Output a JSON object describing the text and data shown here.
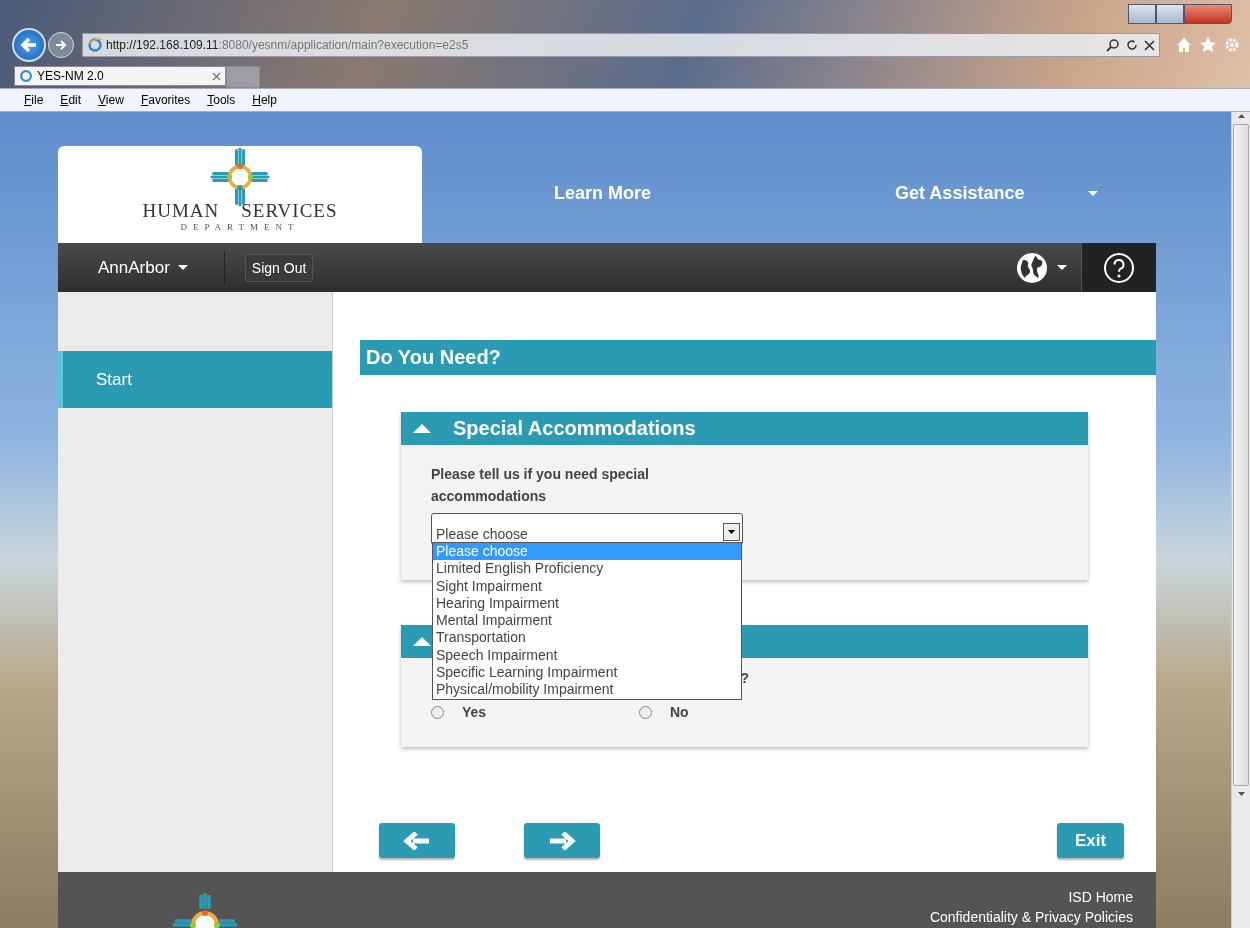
{
  "browser": {
    "address_host": "http://192.168.109.11",
    "address_rest": ":8080/yesnm/application/main?execution=e2s5",
    "tab_title": "YES-NM 2.0",
    "menu": [
      "File",
      "Edit",
      "View",
      "Favorites",
      "Tools",
      "Help"
    ]
  },
  "header": {
    "logo_word_left": "HUMAN",
    "logo_word_right": "SERVICES",
    "logo_subtitle": "DEPARTMENT",
    "nav": [
      "Learn More",
      "Get Assistance"
    ]
  },
  "userbar": {
    "user": "AnnArbor",
    "sign_out": "Sign Out"
  },
  "sidebar": {
    "items": [
      {
        "label": "Start",
        "selected": true
      }
    ]
  },
  "page_title": "Do You Need?",
  "accommodations": {
    "title": "Special Accommodations",
    "prompt": "Please tell us if you need special accommodations",
    "select": {
      "value": "Please choose",
      "expanded": true,
      "options": [
        {
          "label": "Please choose",
          "selected": true
        },
        {
          "label": "Limited English Proficiency",
          "selected": false
        },
        {
          "label": "Sight Impairment",
          "selected": false
        },
        {
          "label": "Hearing Impairment",
          "selected": false
        },
        {
          "label": "Mental Impairment",
          "selected": false
        },
        {
          "label": "Transportation",
          "selected": false
        },
        {
          "label": "Speech Impairment",
          "selected": false
        },
        {
          "label": "Specific Learning Impairment",
          "selected": false
        },
        {
          "label": "Physical/mobility Impairment",
          "selected": false
        }
      ]
    }
  },
  "second_card": {
    "question_tail": "?",
    "options": [
      {
        "label": "Yes",
        "selected": false
      },
      {
        "label": "No",
        "selected": false
      }
    ]
  },
  "nav_buttons": {
    "exit": "Exit"
  },
  "footer": {
    "links": [
      "ISD Home",
      "Confidentiality & Privacy Policies"
    ]
  }
}
